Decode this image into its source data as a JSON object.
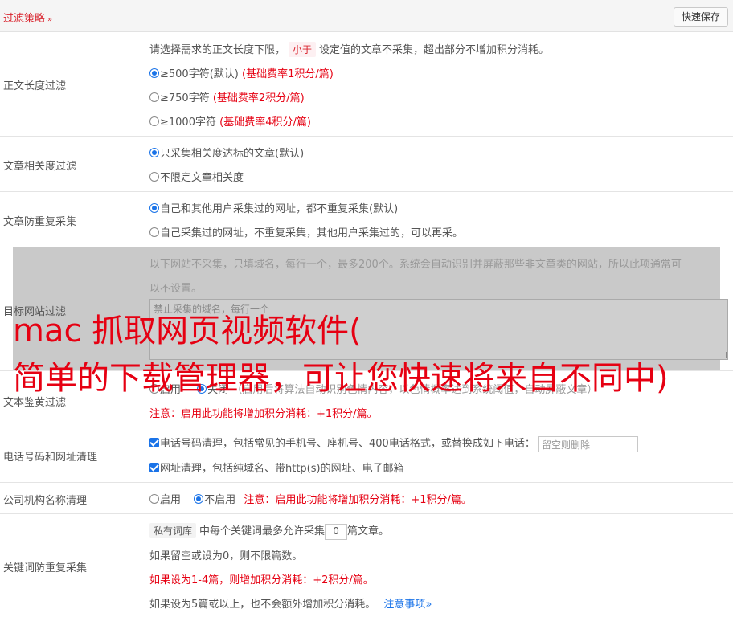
{
  "header": {
    "title": "过滤策略",
    "chevron": "»",
    "save_label": "快速保存"
  },
  "length_filter": {
    "label": "正文长度过滤",
    "desc_a": "请选择需求的正文长度下限，",
    "desc_tag": "小于",
    "desc_b": "设定值的文章不采集，超出部分不增加积分消耗。",
    "options": [
      {
        "text": "≥500字符(默认)",
        "note": "(基础费率1积分/篇)",
        "selected": true
      },
      {
        "text": "≥750字符",
        "note": "(基础费率2积分/篇)",
        "selected": false
      },
      {
        "text": "≥1000字符",
        "note": "(基础费率4积分/篇)",
        "selected": false
      }
    ]
  },
  "relevance": {
    "label": "文章相关度过滤",
    "options": [
      {
        "text": "只采集相关度达标的文章(默认)",
        "selected": true
      },
      {
        "text": "不限定文章相关度",
        "selected": false
      }
    ]
  },
  "dedupe": {
    "label": "文章防重复采集",
    "options": [
      {
        "text": "自己和其他用户采集过的网址，都不重复采集(默认)",
        "selected": true
      },
      {
        "text": "自己采集过的网址，不重复采集，其他用户采集过的，可以再采。",
        "selected": false
      }
    ]
  },
  "target_site": {
    "label": "目标网站过滤",
    "desc1": "以下网站不采集，只填域名，每行一个，最多200个。系统会自动识别并屏蔽那些非文章类的网站，所以此项通常可",
    "desc2": "以不设置。",
    "placeholder": "禁止采集的域名，每行一个"
  },
  "watermark": {
    "line1": "mac 抓取网页视频软件(",
    "line2": "简单的下载管理器，可让您快速将来自不同中)"
  },
  "nsfw": {
    "label": "文本鉴黄过滤",
    "opt_on": "启用",
    "opt_off": "关闭",
    "desc": "（启用后将算法自动识别色情内容，以色情概率达到系统阈值，自动屏蔽文章）",
    "note": "注意：启用此功能将增加积分消耗：+1积分/篇。"
  },
  "phone": {
    "label": "电话号码和网址清理",
    "opt1": "电话号码清理，包括常见的手机号、座机号、400电话格式，或替换成如下电话：",
    "opt1_placeholder": "留空则删除",
    "opt2": "网址清理，包括纯域名、带http(s)的网址、电子邮箱"
  },
  "company": {
    "label": "公司机构名称清理",
    "opt_on": "启用",
    "opt_off": "不启用",
    "note": "注意：启用此功能将增加积分消耗：+1积分/篇。"
  },
  "keyword": {
    "label": "关键词防重复采集",
    "tag": "私有词库",
    "text_a": "中每个关键词最多允许采集",
    "value": "0",
    "text_b": "篇文章。",
    "line2": "如果留空或设为0，则不限篇数。",
    "line3": "如果设为1-4篇，则增加积分消耗：+2积分/篇。",
    "line4": "如果设为5篇或以上，也不会额外增加积分消耗。",
    "link": "注意事项",
    "link_chevron": "»"
  }
}
